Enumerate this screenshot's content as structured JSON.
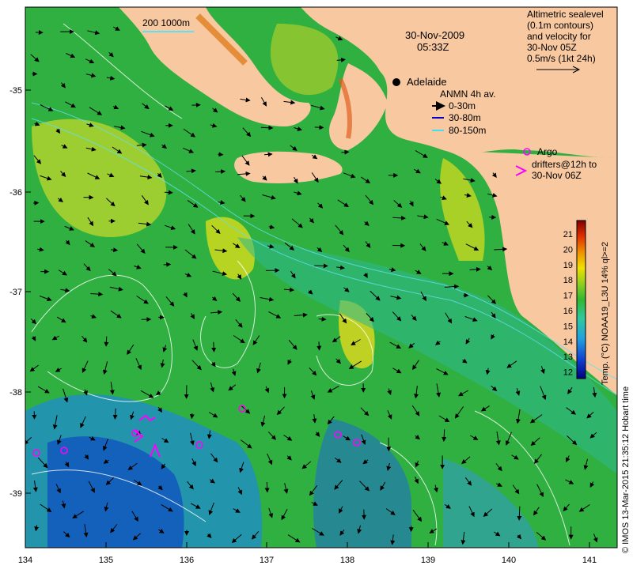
{
  "map": {
    "date": "30-Nov-2009",
    "time": "05:33Z",
    "place_label": "Adelaide",
    "scalebar_label": "200  1000m",
    "altimetry_note": [
      "Altimetric sealevel",
      "(0.1m contours)",
      "and velocity for",
      "30-Nov 05Z",
      "0.5m/s (1kt 24h)"
    ],
    "anmn_title": "ANMN 4h av.",
    "anmn_legend": [
      {
        "label": "0-30m",
        "color": "#000000"
      },
      {
        "label": "30-80m",
        "color": "#0000cc"
      },
      {
        "label": "80-150m",
        "color": "#40e0f0"
      }
    ],
    "argo_label": "Argo",
    "drifters_note": [
      "drifters@12h to",
      "30-Nov 06Z"
    ],
    "colorbar_title": "Temp. (°C) NOAA19_L3U 14% ql>=2",
    "colorbar_ticks": [
      "21",
      "20",
      "19",
      "18",
      "17",
      "16",
      "15",
      "14",
      "13",
      "12"
    ],
    "credit": "© IMOS 13-Mar-2015 21:35:12 Hobart time",
    "x_ticks": [
      "134",
      "135",
      "136",
      "137",
      "138",
      "139",
      "140",
      "141"
    ],
    "y_ticks": [
      "-35",
      "-36",
      "-37",
      "-38",
      "-39"
    ],
    "colors": {
      "land": "#f8c8a0",
      "argo": "#ff00ff",
      "arrow": "#000000"
    }
  }
}
